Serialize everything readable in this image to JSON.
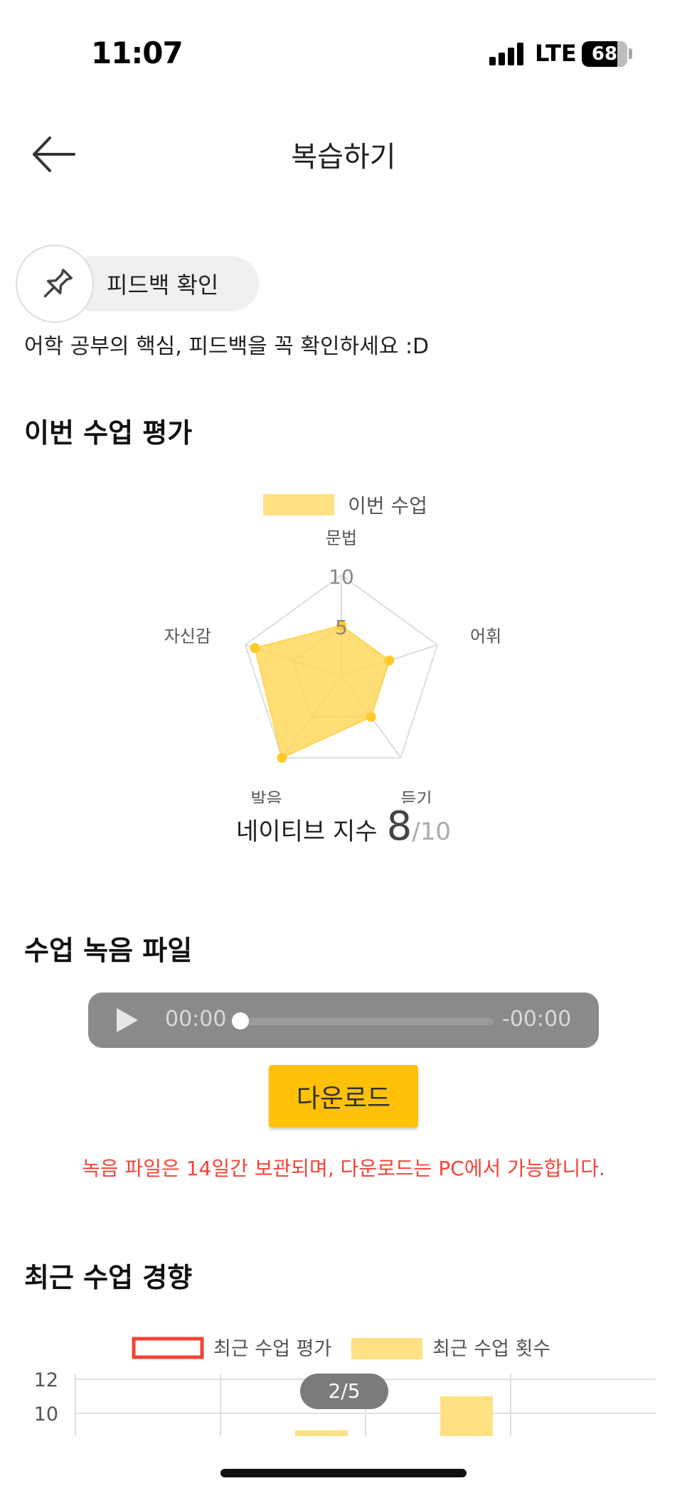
{
  "status_bar": {
    "time": "11:07",
    "network": "LTE",
    "battery": "68"
  },
  "nav": {
    "title": "복습하기"
  },
  "feedback": {
    "label": "피드백 확인",
    "subtext": "어학 공부의 핵심, 피드백을 꼭 확인하세요 :D"
  },
  "evaluation": {
    "title": "이번 수업 평가",
    "legend": "이번 수업",
    "native_label": "네이티브 지수",
    "native_value": "8",
    "native_max": "/10"
  },
  "recording": {
    "title": "수업 녹음 파일",
    "current_time": "00:00",
    "remaining_time": "-00:00",
    "progress": 0,
    "download_label": "다운로드",
    "notice": "녹음 파일은 14일간 보관되며, 다운로드는 PC에서 가능합니다."
  },
  "trends": {
    "title": "최근 수업 경향",
    "legend_eval": "최근 수업 평가",
    "legend_count": "최근 수업 횟수",
    "page_indicator": "2/5"
  },
  "colors": {
    "accent": "#ffc107",
    "radar_fill": "#ffd54f",
    "notice": "#f44336",
    "eval_legend_border": "#f44336"
  },
  "chart_data": [
    {
      "type": "radar",
      "series": [
        {
          "name": "이번 수업",
          "values": [
            5,
            5,
            5,
            10,
            9
          ]
        }
      ],
      "categories": [
        "문법",
        "어휘",
        "듣기",
        "발음",
        "자신감"
      ],
      "ticks": [
        "5",
        "10"
      ],
      "rlim": [
        0,
        10
      ]
    },
    {
      "type": "bar",
      "series": [
        {
          "name": "최근 수업 횟수",
          "values": [
            null,
            9,
            11,
            null
          ]
        },
        {
          "name": "최근 수업 평가",
          "values": []
        }
      ],
      "y_ticks": [
        "10",
        "12"
      ]
    }
  ]
}
